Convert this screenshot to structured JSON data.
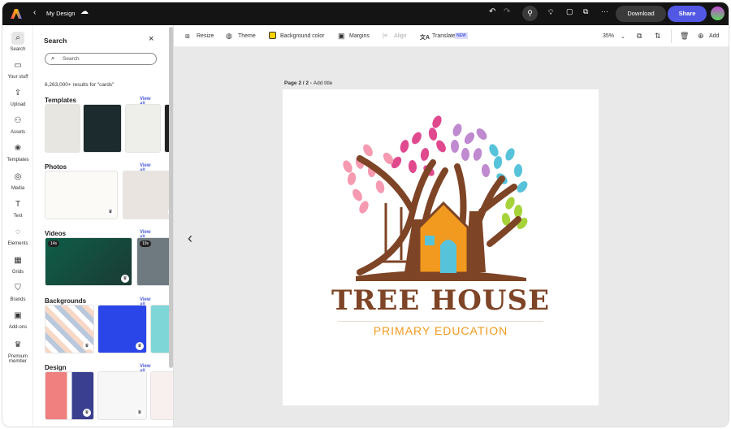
{
  "topbar": {
    "title": "My Design",
    "download": "Download",
    "share": "Share",
    "icons": [
      "adobe-express-logo",
      "back-chevron",
      "cloud",
      "undo",
      "redo",
      "invite-user",
      "lightbulb",
      "comment",
      "present",
      "more"
    ]
  },
  "rail": [
    {
      "label": "Search",
      "icon": "⌕"
    },
    {
      "label": "Your stuff",
      "icon": "▭"
    },
    {
      "label": "Upload",
      "icon": "⇪"
    },
    {
      "label": "Assets",
      "icon": "⚇"
    },
    {
      "label": "Templates",
      "icon": "❀"
    },
    {
      "label": "Media",
      "icon": "◎"
    },
    {
      "label": "Text",
      "icon": "T"
    },
    {
      "label": "Elements",
      "icon": "◌"
    },
    {
      "label": "Grids",
      "icon": "▦"
    },
    {
      "label": "Brands",
      "icon": "⛉"
    },
    {
      "label": "Add-ons",
      "icon": "▣"
    },
    {
      "label": "Premium member",
      "icon": "♛"
    }
  ],
  "panel": {
    "title": "Search",
    "search_placeholder": "Search",
    "results": "6,263,000+ results for \"cards\"",
    "view_all": "View all",
    "sections": [
      {
        "title": "Templates"
      },
      {
        "title": "Photos"
      },
      {
        "title": "Videos",
        "badges": [
          "14s",
          "19s"
        ]
      },
      {
        "title": "Backgrounds"
      },
      {
        "title": "Design assets"
      }
    ]
  },
  "toolbar": {
    "resize": "Resize",
    "theme": "Theme",
    "bgcolor": "Background color",
    "margins": "Margins",
    "align": "Align",
    "translate": "Translate",
    "new_badge": "NEW",
    "zoom": "35%",
    "add": "Add"
  },
  "canvas": {
    "page_label": "Page 2 / 2 - ",
    "add_title": "Add title"
  },
  "logo": {
    "title": "TREE HOUSE",
    "subtitle": "PRIMARY EDUCATION"
  },
  "colors": {
    "accent": "#5258e4",
    "brown": "#7e4426",
    "orange": "#f29a1f"
  }
}
